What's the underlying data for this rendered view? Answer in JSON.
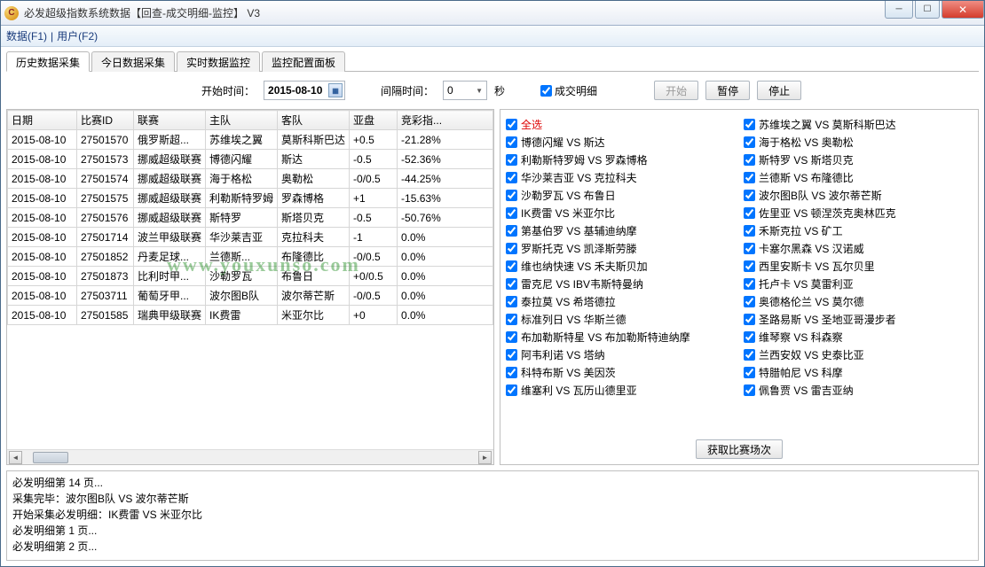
{
  "titlebar": {
    "title": "必发超级指数系统数据【回查-成交明细-监控】 V3"
  },
  "menu": {
    "data": "数据(F1)",
    "sep": "|",
    "user": "用户(F2)"
  },
  "tabs": {
    "t0": "历史数据采集",
    "t1": "今日数据采集",
    "t2": "实时数据监控",
    "t3": "监控配置面板"
  },
  "toolbar": {
    "start_time_label": "开始时间：",
    "start_time_value": "2015-08-10",
    "interval_label": "间隔时间：",
    "interval_value": "0",
    "interval_unit": "秒",
    "detail_label": "成交明细",
    "btn_start": "开始",
    "btn_pause": "暂停",
    "btn_stop": "停止"
  },
  "table": {
    "headers": {
      "date": "日期",
      "id": "比赛ID",
      "league": "联赛",
      "home": "主队",
      "away": "客队",
      "asia": "亚盘",
      "jc": "竞彩指..."
    },
    "rows": [
      {
        "date": "2015-08-10",
        "id": "27501570",
        "league": "俄罗斯超...",
        "home": "苏维埃之翼",
        "away": "莫斯科斯巴达",
        "asia": "+0.5",
        "jc": "-21.28%"
      },
      {
        "date": "2015-08-10",
        "id": "27501573",
        "league": "挪威超级联赛",
        "home": "博德闪耀",
        "away": "斯达",
        "asia": "-0.5",
        "jc": "-52.36%"
      },
      {
        "date": "2015-08-10",
        "id": "27501574",
        "league": "挪威超级联赛",
        "home": "海于格松",
        "away": "奥勒松",
        "asia": "-0/0.5",
        "jc": "-44.25%"
      },
      {
        "date": "2015-08-10",
        "id": "27501575",
        "league": "挪威超级联赛",
        "home": "利勒斯特罗姆",
        "away": "罗森博格",
        "asia": "+1",
        "jc": "-15.63%"
      },
      {
        "date": "2015-08-10",
        "id": "27501576",
        "league": "挪威超级联赛",
        "home": "斯特罗",
        "away": "斯塔贝克",
        "asia": "-0.5",
        "jc": "-50.76%"
      },
      {
        "date": "2015-08-10",
        "id": "27501714",
        "league": "波兰甲级联赛",
        "home": "华沙莱吉亚",
        "away": "克拉科夫",
        "asia": "-1",
        "jc": "0.0%"
      },
      {
        "date": "2015-08-10",
        "id": "27501852",
        "league": "丹麦足球...",
        "home": "兰德斯...",
        "away": "布隆德比",
        "asia": "-0/0.5",
        "jc": "0.0%"
      },
      {
        "date": "2015-08-10",
        "id": "27501873",
        "league": "比利时甲...",
        "home": "沙勒罗瓦",
        "away": "布鲁日",
        "asia": "+0/0.5",
        "jc": "0.0%"
      },
      {
        "date": "2015-08-10",
        "id": "27503711",
        "league": "葡萄牙甲...",
        "home": "波尔图B队",
        "away": "波尔蒂芒斯",
        "asia": "-0/0.5",
        "jc": "0.0%"
      },
      {
        "date": "2015-08-10",
        "id": "27501585",
        "league": "瑞典甲级联赛",
        "home": "IK费雷",
        "away": "米亚尔比",
        "asia": "+0",
        "jc": "0.0%"
      }
    ]
  },
  "matches": {
    "select_all": "全选",
    "left": [
      "博德闪耀 VS 斯达",
      "利勒斯特罗姆 VS 罗森博格",
      "华沙莱吉亚 VS 克拉科夫",
      "沙勒罗瓦 VS 布鲁日",
      "IK费雷 VS 米亚尔比",
      "第基伯罗 VS 基辅迪纳摩",
      "罗斯托克 VS 凯泽斯劳滕",
      "维也纳快速 VS 禾夫斯贝加",
      "雷克尼 VS IBV韦斯特曼纳",
      "泰拉莫 VS 希塔德拉",
      "标准列日 VS 华斯兰德",
      "布加勒斯特星 VS 布加勒斯特迪纳摩",
      "阿韦利诺 VS 塔纳",
      "科特布斯 VS 美因茨",
      "维塞利 VS 瓦历山德里亚"
    ],
    "right": [
      "苏维埃之翼 VS 莫斯科斯巴达",
      "海于格松 VS 奥勒松",
      "斯特罗 VS 斯塔贝克",
      "兰德斯 VS 布隆德比",
      "波尔图B队 VS 波尔蒂芒斯",
      "佐里亚 VS 顿涅茨克奥林匹克",
      "禾斯克拉 VS 矿工",
      "卡塞尔黑森 VS 汉诺威",
      "西里安斯卡 VS 瓦尔贝里",
      "托卢卡 VS 莫雷利亚",
      "奥德格伦兰 VS 莫尔德",
      "圣路易斯 VS 圣地亚哥漫步者",
      "维琴察 VS 科森察",
      "兰西安奴 VS 史泰比亚",
      "特腊帕尼 VS 科摩",
      "佩鲁贾 VS 雷吉亚纳"
    ],
    "fetch_btn": "获取比赛场次"
  },
  "log": {
    "lines": [
      "必发明细第 14 页...",
      "采集完毕：波尔图B队 VS 波尔蒂芒斯",
      "开始采集必发明细：IK费雷 VS 米亚尔比",
      "必发明细第 1 页...",
      "必发明细第 2 页..."
    ]
  },
  "watermark": "www.youxunso.com"
}
